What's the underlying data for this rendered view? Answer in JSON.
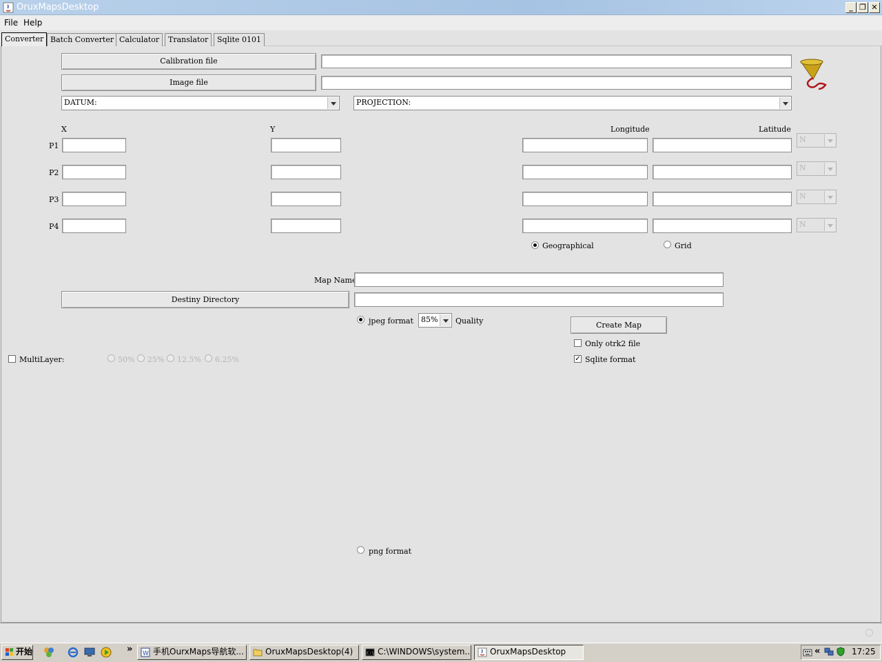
{
  "window": {
    "title": "OruxMapsDesktop"
  },
  "menu": {
    "items": [
      "File",
      "Help"
    ]
  },
  "tabs": [
    "Converter",
    "Batch Converter",
    "Calculator",
    "Translator",
    "Sqlite 0101"
  ],
  "converter": {
    "calibration_button": "Calibration file",
    "image_button": "Image file",
    "datum_label": "DATUM:",
    "projection_label": "PROJECTION:",
    "headers": {
      "x": "X",
      "y": "Y",
      "longitude": "Longitude",
      "latitude": "Latitude"
    },
    "points": [
      "P1",
      "P2",
      "P3",
      "P4"
    ],
    "hemisphere_value": "N",
    "coord_mode": {
      "geographical": "Geographical",
      "grid": "Grid",
      "selected": "Geographical"
    },
    "map_name_label": "Map Name",
    "destiny_button": "Destiny Directory",
    "jpeg_label": "jpeg format",
    "quality_value": "85%",
    "quality_label": "Quality",
    "create_button": "Create Map",
    "only_otrk2_label": "Only otrk2 file",
    "only_otrk2_checked": false,
    "sqlite_label": "Sqlite format",
    "sqlite_checked": true,
    "multilayer_label": "MultiLayer:",
    "multilayer_checked": false,
    "layer_options": [
      "50%",
      "25%",
      "12.5%",
      "6.25%"
    ],
    "png_label": "png format"
  },
  "taskbar": {
    "start_label": "开始",
    "tasks": [
      {
        "label": "手机OurxMaps导航软...",
        "icon": "word-doc-icon",
        "active": false
      },
      {
        "label": "OruxMapsDesktop(4)",
        "icon": "folder-icon",
        "active": false
      },
      {
        "label": "C:\\WINDOWS\\system...",
        "icon": "console-icon",
        "active": false
      },
      {
        "label": "OruxMapsDesktop",
        "icon": "java-icon",
        "active": true
      }
    ],
    "clock": "17:25"
  }
}
